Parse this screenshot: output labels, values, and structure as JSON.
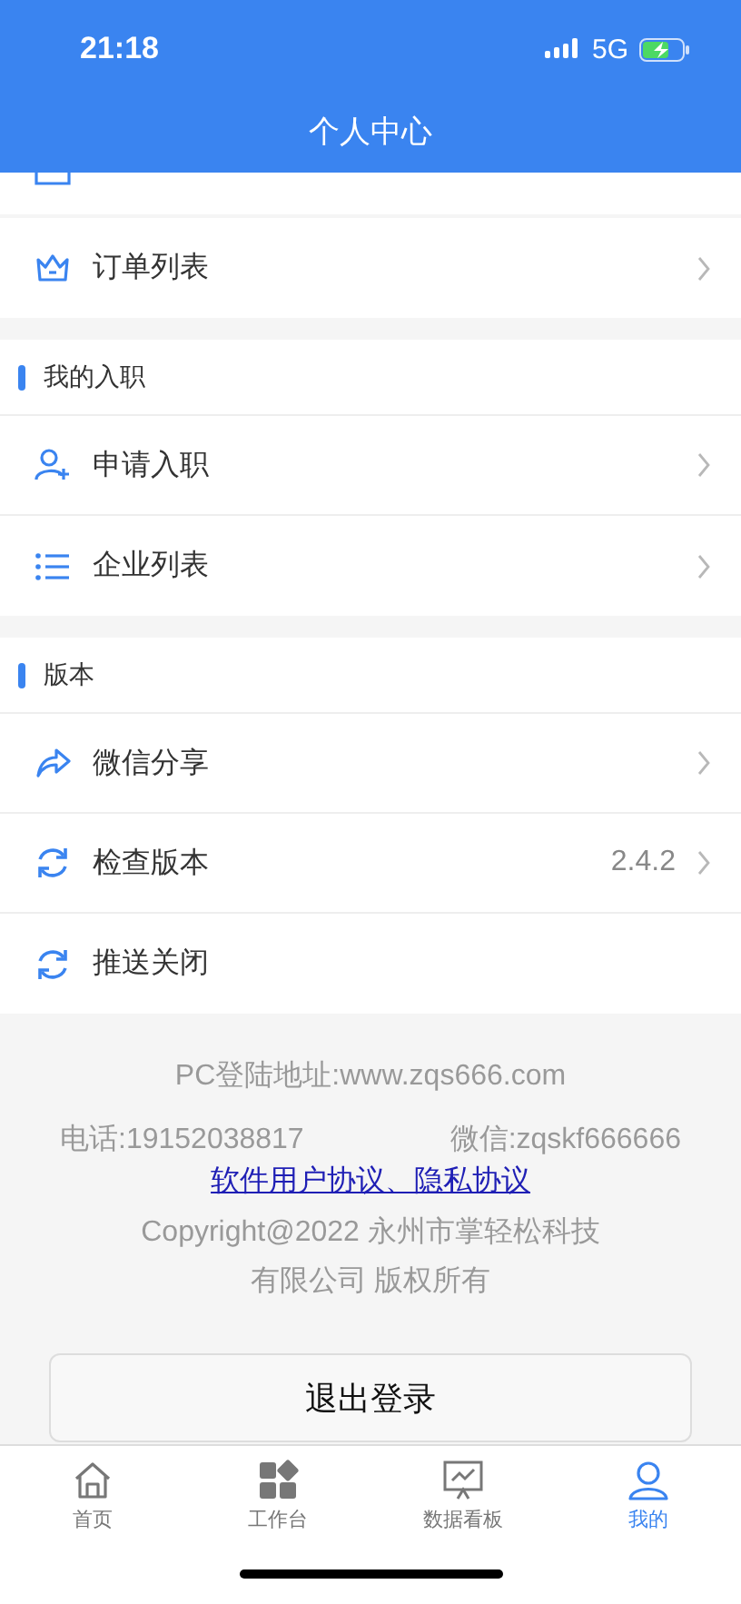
{
  "status_bar": {
    "time": "21:18",
    "network": "5G"
  },
  "header": {
    "title": "个人中心"
  },
  "groups": [
    {
      "items": [
        {
          "kind": "crown",
          "label": "订单列表"
        }
      ]
    },
    {
      "title": "我的入职",
      "items": [
        {
          "kind": "user-add",
          "label": "申请入职"
        },
        {
          "kind": "list",
          "label": "企业列表"
        }
      ]
    },
    {
      "title": "版本",
      "items": [
        {
          "kind": "share",
          "label": "微信分享"
        },
        {
          "kind": "refresh",
          "label": "检查版本",
          "value": "2.4.2"
        },
        {
          "kind": "refresh",
          "label": "推送关闭",
          "chevron": false
        }
      ]
    }
  ],
  "footer": {
    "pc_address": "PC登陆地址:www.zqs666.com",
    "phone": "电话:19152038817",
    "wechat": "微信:zqskf666666",
    "agreement_link": "软件用户协议、隐私协议",
    "copyright": "Copyright@2022 永州市掌轻松科技有限公司 版权所有"
  },
  "logout_button": "退出登录",
  "tabs": [
    {
      "kind": "home",
      "label": "首页",
      "selected": false
    },
    {
      "kind": "grid",
      "label": "工作台",
      "selected": false
    },
    {
      "kind": "board",
      "label": "数据看板",
      "selected": false
    },
    {
      "kind": "person",
      "label": "我的",
      "selected": true
    }
  ]
}
